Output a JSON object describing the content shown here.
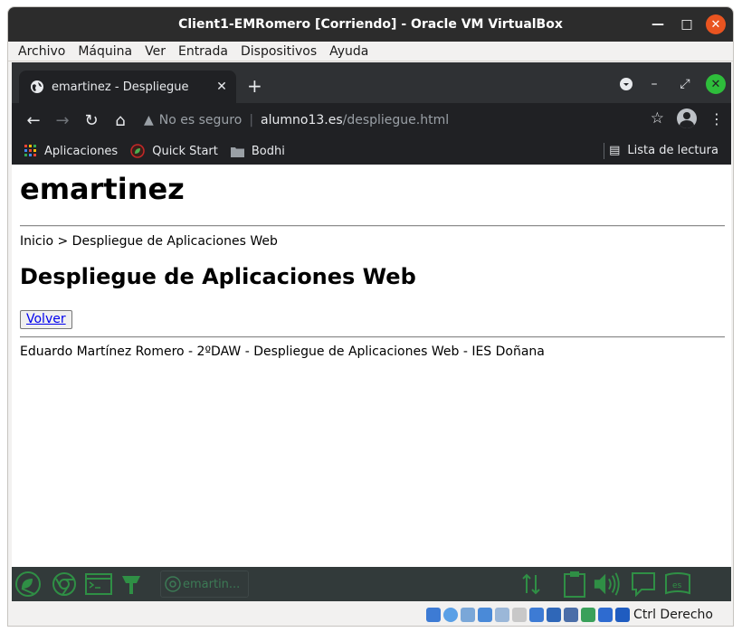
{
  "vbox": {
    "title": "Client1-EMRomero [Corriendo] - Oracle VM VirtualBox",
    "menu": [
      "Archivo",
      "Máquina",
      "Ver",
      "Entrada",
      "Dispositivos",
      "Ayuda"
    ],
    "host_key": "Ctrl Derecho"
  },
  "browser": {
    "tab_title": "emartinez - Despliegue",
    "security_label": "No es seguro",
    "url_host": "alumno13.es",
    "url_path": "/despliegue.html",
    "bookmarks": [
      "Aplicaciones",
      "Quick Start",
      "Bodhi"
    ],
    "reading_list": "Lista de lectura"
  },
  "page": {
    "site_title": "emartinez",
    "breadcrumb": "Inicio > Despliegue de Aplicaciones Web",
    "heading": "Despliegue de Aplicaciones Web",
    "back_button": "Volver",
    "footer": "Eduardo Martínez Romero - 2ºDAW - Despliegue de Aplicaciones Web - IES Doñana"
  },
  "taskbar": {
    "task_label": "emartin..."
  },
  "colors": {
    "accent_close": "#e95420",
    "chrome_dark": "#202124",
    "bodhi_green": "#2f8f45"
  }
}
